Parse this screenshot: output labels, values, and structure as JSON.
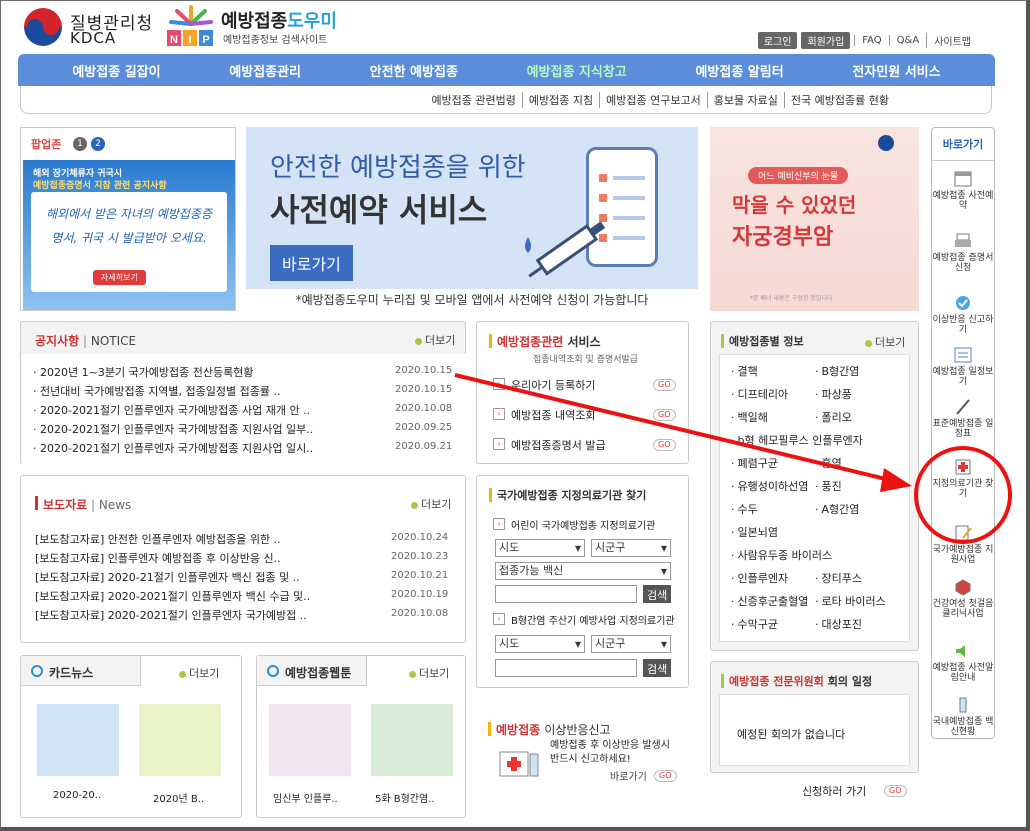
{
  "header": {
    "kdca_name": "질병관리청",
    "kdca_en": "KDCA",
    "nip_title_a": "예방접종",
    "nip_title_b": "도우미",
    "nip_sub": "예방접종정보 검색사이트",
    "nip_letters": "NIP",
    "login": "로그인",
    "join": "회원가입",
    "links": [
      "FAQ",
      "Q&A",
      "사이트맵"
    ]
  },
  "nav": {
    "items": [
      "예방접종 길잡이",
      "예방접종관리",
      "안전한 예방접종",
      "예방접종 지식창고",
      "예방접종 알림터",
      "전자민원 서비스"
    ],
    "active": "예방접종 지식창고"
  },
  "subnav": [
    "예방접종 관련법령",
    "예방접종 지침",
    "예방접종 연구보고서",
    "홍보물 자료실",
    "전국 예방접종률 현황"
  ],
  "popup": {
    "title": "팝업존",
    "num1": "1",
    "num2": "2",
    "line1": "해외 장기체류자 귀국시",
    "line2": "예방접종증명서 지참 관련 공지사항",
    "card": "해외에서 받은 자녀의 예방접종증명서, 귀국 시 발급받아 오세요.",
    "btn": "자세히보기"
  },
  "banner": {
    "t1": "안전한 예방접종을 위한",
    "t2": "사전예약 서비스",
    "btn": "바로가기",
    "foot": "*예방접종도우미 누리집 및 모바일 앱에서 사전예약 신청이 가능합니다"
  },
  "rbanner": {
    "tag": "어느 예비신부의 눈물",
    "t1": "막을 수 있었던",
    "t2": "자궁경부암",
    "note": "*본 배너 내용은 구성된 것입니다"
  },
  "notice": {
    "title": "공지사항",
    "title_en": "NOTICE",
    "more": "더보기",
    "rows": [
      {
        "text": "2020년 1~3분기 국가예방접종 전산등록현황",
        "date": "2020.10.15"
      },
      {
        "text": "전년대비 국가예방접종 지역별, 접종일정별 접종률 ..",
        "date": "2020.10.15"
      },
      {
        "text": "2020-2021절기 인플루엔자 국가예방접종 사업 재개 안 ..",
        "date": "2020.10.08"
      },
      {
        "text": "2020-2021절기 인플루엔자 국가예방접종 지원사업 일부..",
        "date": "2020.09.25"
      },
      {
        "text": "2020-2021절기 인플루엔자 국가예방접종 지원사업 일시..",
        "date": "2020.09.21"
      }
    ]
  },
  "press": {
    "title": "보도자료",
    "title_en": "News",
    "more": "더보기",
    "rows": [
      {
        "text": "[보도참고자료] 안전한 인플루엔자 예방접종을 위한 ..",
        "date": "2020.10.24"
      },
      {
        "text": "[보도참고자료] 인플루엔자 예방접종 후 이상반응 신..",
        "date": "2020.10.23"
      },
      {
        "text": "[보도참고자료] 2020-21절기 인플루엔자 백신 접종 및 ..",
        "date": "2020.10.21"
      },
      {
        "text": "[보도참고자료] 2020-2021절기 인플루엔자 백신 수급 및..",
        "date": "2020.10.19"
      },
      {
        "text": "[보도참고자료] 2020-2021절기 인플루엔자 국가예방접 ..",
        "date": "2020.10.08"
      }
    ]
  },
  "cardnews": {
    "title": "카드뉴스",
    "more": "더보기",
    "items": [
      "2020-20..",
      "2020년 B.."
    ]
  },
  "webtoon": {
    "title": "예방접종웹툰",
    "more": "더보기",
    "items": [
      "임신부 인플루..",
      "5화 B형간염.."
    ]
  },
  "service": {
    "title_a": "예방접종관련",
    "title_b": "서비스",
    "sub": "접종내역조회 및 증명서발급",
    "items": [
      "우리아기 등록하기",
      "예방접종 내역조회",
      "예방접종증명서 발급"
    ],
    "go": "GO"
  },
  "clinic": {
    "title": "국가예방접종 지정의료기관 찾기",
    "child_label": "어린이 국가예방접종 지정의료기관",
    "hep_label": "B형간염 주산기 예방사업 지정의료기관",
    "sido": "시도",
    "sigungu": "시군구",
    "vaccine": "접종가능 백신",
    "search": "검색"
  },
  "adverse": {
    "title_a": "예방접종",
    "title_b": "이상반응신고",
    "desc1": "예방접종 후 이상반응 발생시",
    "desc2": "반드시 신고하세요!",
    "link": "바로가기",
    "go": "GO"
  },
  "vaccines": {
    "title": "예방접종별 정보",
    "more": "더보기",
    "col1": [
      "결핵",
      "디프테리아",
      "백일해",
      "b형 헤모필루스 인플루엔자",
      "폐렴구균",
      "유행성이하선염",
      "수두",
      "일본뇌염",
      "사람유두종 바이러스",
      "인플루엔자",
      "신증후군출혈열",
      "수막구균"
    ],
    "col2": [
      "B형간염",
      "파상풍",
      "폴리오",
      "",
      "홍역",
      "풍진",
      "A형간염",
      "",
      "",
      "장티푸스",
      "로타 바이러스",
      "대상포진"
    ]
  },
  "committee": {
    "title_a": "예방접종 전문위원회",
    "title_b": "회의 일정",
    "empty": "예정된 회의가 없습니다",
    "apply": "신청하러 가기",
    "go": "GO"
  },
  "quick": {
    "title": "바로가기",
    "items": [
      "예방접종 사전예약",
      "예방접종 증명서 신청",
      "이상반응 신고하기",
      "예방접종 일정보기",
      "표준예방접종 일정표",
      "지정의료기관 찾기",
      "국가예방접종 지원사업",
      "건강여성 첫걸음 클리닉사업",
      "예방접종 사전알림안내",
      "국내예방접종 백신현황"
    ]
  },
  "colors": {
    "nav": "#5b8dd9",
    "active": "#b9f7c6",
    "accent_red": "#e11111",
    "title_blue": "#2a63b8"
  }
}
